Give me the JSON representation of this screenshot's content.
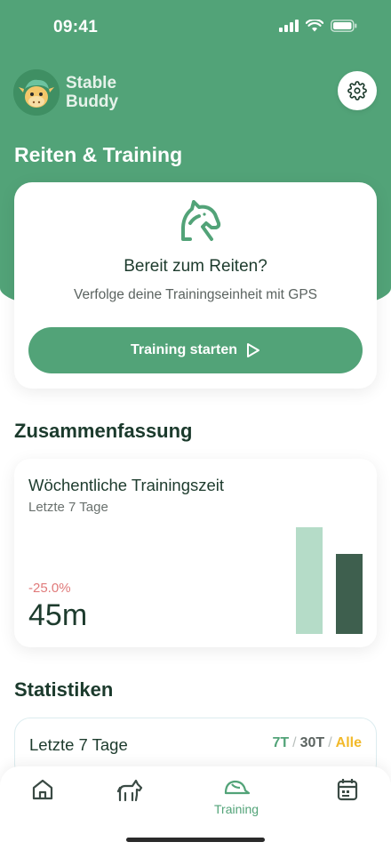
{
  "status_bar": {
    "time": "09:41"
  },
  "brand": {
    "line1": "Stable",
    "line2": "Buddy"
  },
  "page": {
    "title": "Reiten & Training"
  },
  "ride_card": {
    "title": "Bereit zum Reiten?",
    "subtitle": "Verfolge deine Trainingseinheit mit GPS",
    "button_label": "Training starten"
  },
  "summary": {
    "heading": "Zusammenfassung",
    "card_title": "Wöchentliche Trainingszeit",
    "card_subtitle": "Letzte 7 Tage",
    "change": "-25.0%",
    "value": "45m",
    "bars": [
      {
        "period": "previous",
        "relative_level": 1.0,
        "color": "#b5dcc8"
      },
      {
        "period": "current",
        "relative_level": 0.75,
        "color": "#3e5f4e"
      }
    ]
  },
  "statistics": {
    "heading": "Statistiken",
    "range_label": "Letzte 7 Tage",
    "ranges": [
      "7T",
      "30T",
      "Alle"
    ],
    "range_colors": [
      "#52a378",
      "#5b6360",
      "#f2b92a"
    ]
  },
  "tabbar": {
    "items": [
      {
        "icon": "home-icon",
        "label": ""
      },
      {
        "icon": "horse-icon",
        "label": ""
      },
      {
        "icon": "riding-helmet-icon",
        "label": "Training",
        "active": true
      },
      {
        "icon": "calendar-icon",
        "label": ""
      }
    ]
  },
  "colors": {
    "primary": "#52a378",
    "dark": "#1d3b2d",
    "negative": "#e07a7a",
    "accent_yellow": "#f2b92a"
  }
}
